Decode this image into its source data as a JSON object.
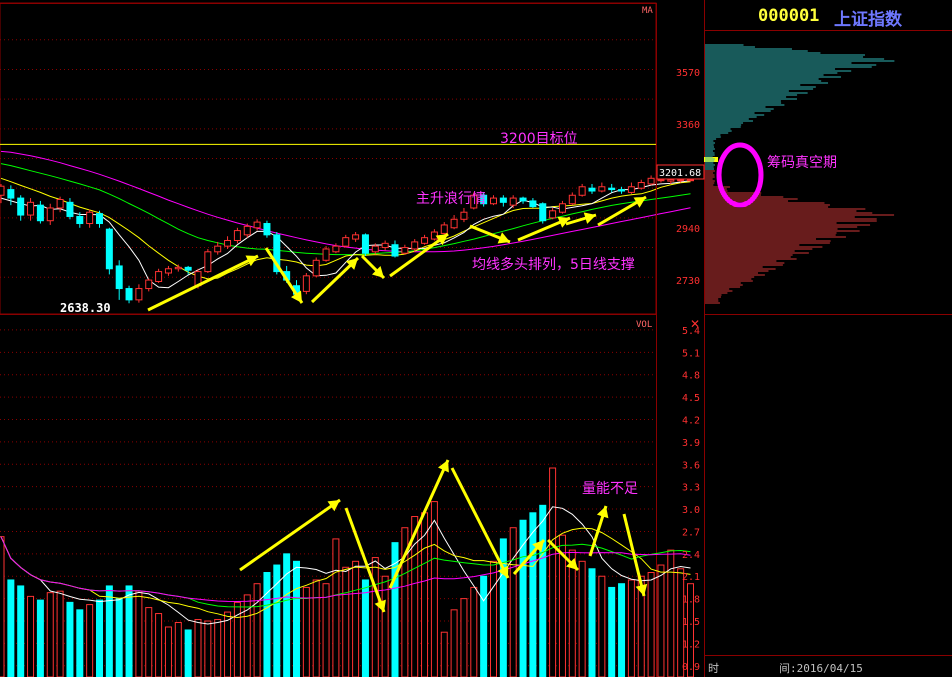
{
  "header": {
    "code": "000001",
    "name": "上证指数"
  },
  "colors": {
    "up": "#ff3232",
    "down": "#00ffff",
    "ma5": "#ffffff",
    "ma10": "#ffff00",
    "ma20": "#00ff00",
    "ma30": "#ff00ff",
    "annotation": "#ff33ff",
    "arrow": "#ffff00",
    "grid": "#8a0000",
    "axis": "#ff3030"
  },
  "price_panel": {
    "indicator_label": "MA",
    "low_label": "2638.30",
    "current_price_label": "3201.68",
    "y_ticks": [
      "3570",
      "3360",
      "2940",
      "2730"
    ],
    "annotations": [
      {
        "text": "3200目标位"
      },
      {
        "text": "主升浪行情"
      },
      {
        "text": "均线多头排列，5日线支撑"
      },
      {
        "text": "筹码真空期"
      }
    ]
  },
  "volume_panel": {
    "indicator_label": "VOL",
    "y_ticks": [
      "5.4",
      "5.1",
      "4.8",
      "4.5",
      "4.2",
      "3.9",
      "3.6",
      "3.3",
      "3.0",
      "2.7",
      "2.4",
      "2.1",
      "1.8",
      "1.5",
      "1.2",
      "0.9"
    ],
    "annotations": [
      {
        "text": "量能不足"
      }
    ]
  },
  "footer": {
    "time_label": "时",
    "date_label": "间:2016/04/15"
  },
  "chart_data": [
    {
      "type": "candlestick",
      "title": "",
      "ylim": [
        2600,
        3700
      ],
      "target_line": 3200,
      "candles": [
        [
          3020,
          3052,
          2992,
          3060
        ],
        [
          3040,
          3010,
          2985,
          3055
        ],
        [
          3010,
          2950,
          2930,
          3020
        ],
        [
          2950,
          2995,
          2930,
          3010
        ],
        [
          2985,
          2930,
          2920,
          3000
        ],
        [
          2930,
          2975,
          2915,
          2990
        ],
        [
          2975,
          3005,
          2960,
          3015
        ],
        [
          2995,
          2945,
          2935,
          3010
        ],
        [
          2945,
          2920,
          2905,
          2960
        ],
        [
          2920,
          2960,
          2905,
          2970
        ],
        [
          2955,
          2920,
          2905,
          2965
        ],
        [
          2900,
          2760,
          2740,
          2905
        ],
        [
          2770,
          2690,
          2650,
          2790
        ],
        [
          2690,
          2650,
          2638,
          2700
        ],
        [
          2650,
          2690,
          2640,
          2705
        ],
        [
          2690,
          2720,
          2680,
          2725
        ],
        [
          2715,
          2750,
          2710,
          2760
        ],
        [
          2745,
          2760,
          2735,
          2770
        ],
        [
          2760,
          2765,
          2750,
          2775
        ],
        [
          2765,
          2755,
          2740,
          2770
        ],
        [
          2700,
          2750,
          2690,
          2760
        ],
        [
          2750,
          2820,
          2745,
          2830
        ],
        [
          2820,
          2840,
          2810,
          2855
        ],
        [
          2840,
          2860,
          2830,
          2875
        ],
        [
          2860,
          2895,
          2850,
          2905
        ],
        [
          2880,
          2910,
          2870,
          2920
        ],
        [
          2905,
          2925,
          2895,
          2935
        ],
        [
          2920,
          2880,
          2870,
          2930
        ],
        [
          2880,
          2750,
          2740,
          2890
        ],
        [
          2750,
          2720,
          2710,
          2770
        ],
        [
          2700,
          2670,
          2660,
          2720
        ],
        [
          2680,
          2735,
          2670,
          2745
        ],
        [
          2735,
          2790,
          2730,
          2800
        ],
        [
          2790,
          2830,
          2785,
          2840
        ],
        [
          2820,
          2840,
          2815,
          2850
        ],
        [
          2840,
          2870,
          2835,
          2880
        ],
        [
          2865,
          2880,
          2855,
          2890
        ],
        [
          2880,
          2815,
          2805,
          2885
        ],
        [
          2820,
          2840,
          2810,
          2850
        ],
        [
          2835,
          2850,
          2825,
          2860
        ],
        [
          2845,
          2805,
          2800,
          2860
        ],
        [
          2815,
          2835,
          2810,
          2845
        ],
        [
          2830,
          2855,
          2820,
          2865
        ],
        [
          2850,
          2870,
          2845,
          2880
        ],
        [
          2865,
          2890,
          2860,
          2900
        ],
        [
          2885,
          2915,
          2880,
          2925
        ],
        [
          2905,
          2935,
          2900,
          2950
        ],
        [
          2935,
          2960,
          2925,
          2975
        ],
        [
          2975,
          3020,
          2970,
          3030
        ],
        [
          3020,
          2990,
          2980,
          3030
        ],
        [
          2990,
          3010,
          2985,
          3020
        ],
        [
          3010,
          2995,
          2980,
          3020
        ],
        [
          2985,
          3010,
          2975,
          3020
        ],
        [
          3010,
          3000,
          2990,
          3015
        ],
        [
          3000,
          2980,
          2975,
          3010
        ],
        [
          2990,
          2930,
          2920,
          2995
        ],
        [
          2940,
          2965,
          2935,
          2975
        ],
        [
          2960,
          2990,
          2955,
          3000
        ],
        [
          2990,
          3020,
          2985,
          3030
        ],
        [
          3020,
          3050,
          3015,
          3060
        ],
        [
          3045,
          3035,
          3025,
          3060
        ],
        [
          3035,
          3050,
          3030,
          3065
        ],
        [
          3045,
          3040,
          3030,
          3060
        ],
        [
          3040,
          3035,
          3025,
          3050
        ],
        [
          3030,
          3050,
          3025,
          3065
        ],
        [
          3045,
          3065,
          3040,
          3075
        ],
        [
          3060,
          3080,
          3055,
          3090
        ],
        [
          3075,
          3075,
          3065,
          3085
        ],
        [
          3070,
          3075,
          3060,
          3085
        ],
        [
          3075,
          3075,
          3065,
          3085
        ],
        [
          3075,
          3075,
          3070,
          3085
        ]
      ],
      "moving_averages": {
        "ma5": [
          3010,
          3000,
          2990,
          2982,
          2984,
          2970,
          2972,
          2960,
          2952,
          2952,
          2951,
          2925,
          2880,
          2838,
          2790,
          2720,
          2695,
          2693,
          2715,
          2738,
          2756,
          2772,
          2795,
          2814,
          2845,
          2870,
          2892,
          2893,
          2873,
          2839,
          2804,
          2763,
          2735,
          2737,
          2745,
          2783,
          2819,
          2842,
          2844,
          2844,
          2833,
          2832,
          2832,
          2832,
          2843,
          2852,
          2869,
          2888,
          2917,
          2935,
          2946,
          2953,
          2983,
          3003,
          2994,
          2978,
          2978,
          2971,
          2977,
          2983,
          2990,
          3010,
          3029,
          3040,
          3040,
          3047,
          3056,
          3060,
          3062,
          3067,
          3072
        ],
        "ma10": [
          3080,
          3068,
          3055,
          3043,
          3030,
          3016,
          3005,
          2991,
          2978,
          2968,
          2958,
          2941,
          2918,
          2895,
          2870,
          2841,
          2815,
          2790,
          2768,
          2748,
          2734,
          2724,
          2727,
          2745,
          2760,
          2777,
          2792,
          2799,
          2794,
          2790,
          2784,
          2773,
          2770,
          2775,
          2790,
          2805,
          2810,
          2808,
          2810,
          2808,
          2808,
          2812,
          2822,
          2838,
          2849,
          2863,
          2876,
          2893,
          2908,
          2923,
          2938,
          2953,
          2966,
          2973,
          2974,
          2974,
          2980,
          2982,
          2984,
          2988,
          2991,
          3000,
          3010,
          3017,
          3022,
          3025,
          3035,
          3048,
          3057,
          3064,
          3068
        ],
        "ma20": [
          3132,
          3125,
          3116,
          3107,
          3098,
          3089,
          3080,
          3070,
          3060,
          3050,
          3039,
          3024,
          3008,
          2991,
          2974,
          2956,
          2937,
          2919,
          2900,
          2884,
          2870,
          2860,
          2852,
          2844,
          2838,
          2833,
          2830,
          2829,
          2825,
          2822,
          2818,
          2815,
          2813,
          2811,
          2810,
          2810,
          2810,
          2812,
          2814,
          2816,
          2818,
          2820,
          2824,
          2829,
          2835,
          2842,
          2849,
          2857,
          2865,
          2874,
          2884,
          2893,
          2902,
          2912,
          2921,
          2930,
          2938,
          2946,
          2954,
          2962,
          2970,
          2977,
          2984,
          2990,
          2995,
          3000,
          3005,
          3010,
          3015,
          3020,
          3025
        ],
        "ma30": [
          3175,
          3172,
          3166,
          3160,
          3152,
          3144,
          3135,
          3125,
          3115,
          3105,
          3094,
          3082,
          3070,
          3057,
          3044,
          3030,
          3017,
          3003,
          2990,
          2977,
          2965,
          2953,
          2942,
          2932,
          2922,
          2913,
          2904,
          2895,
          2886,
          2878,
          2870,
          2862,
          2855,
          2848,
          2842,
          2837,
          2833,
          2829,
          2826,
          2824,
          2822,
          2821,
          2820,
          2820,
          2820,
          2821,
          2823,
          2826,
          2830,
          2834,
          2839,
          2845,
          2851,
          2857,
          2864,
          2871,
          2878,
          2885,
          2892,
          2899,
          2906,
          2913,
          2920,
          2927,
          2934,
          2941,
          2948,
          2955,
          2962,
          2969,
          2976
        ]
      }
    },
    {
      "type": "bar",
      "title": "",
      "ylabel": "",
      "ylim": [
        0.75,
        5.6
      ],
      "values": [
        2.63,
        2.05,
        1.97,
        1.83,
        1.78,
        1.88,
        1.9,
        1.75,
        1.65,
        1.72,
        1.78,
        1.97,
        1.8,
        1.97,
        1.9,
        1.68,
        1.6,
        1.42,
        1.48,
        1.38,
        1.52,
        1.5,
        1.52,
        1.62,
        1.75,
        1.85,
        2.0,
        2.15,
        2.25,
        2.4,
        2.3,
        1.95,
        2.05,
        2.0,
        2.6,
        2.22,
        2.3,
        2.05,
        2.35,
        2.1,
        2.55,
        2.75,
        2.9,
        2.95,
        3.1,
        1.35,
        1.65,
        1.8,
        1.95,
        2.1,
        2.3,
        2.6,
        2.75,
        2.85,
        2.95,
        3.05,
        3.55,
        2.65,
        2.45,
        2.3,
        2.2,
        2.1,
        1.95,
        2.0,
        2.05,
        2.1,
        2.15,
        2.25,
        2.45,
        2.2,
        2.0
      ]
    }
  ]
}
